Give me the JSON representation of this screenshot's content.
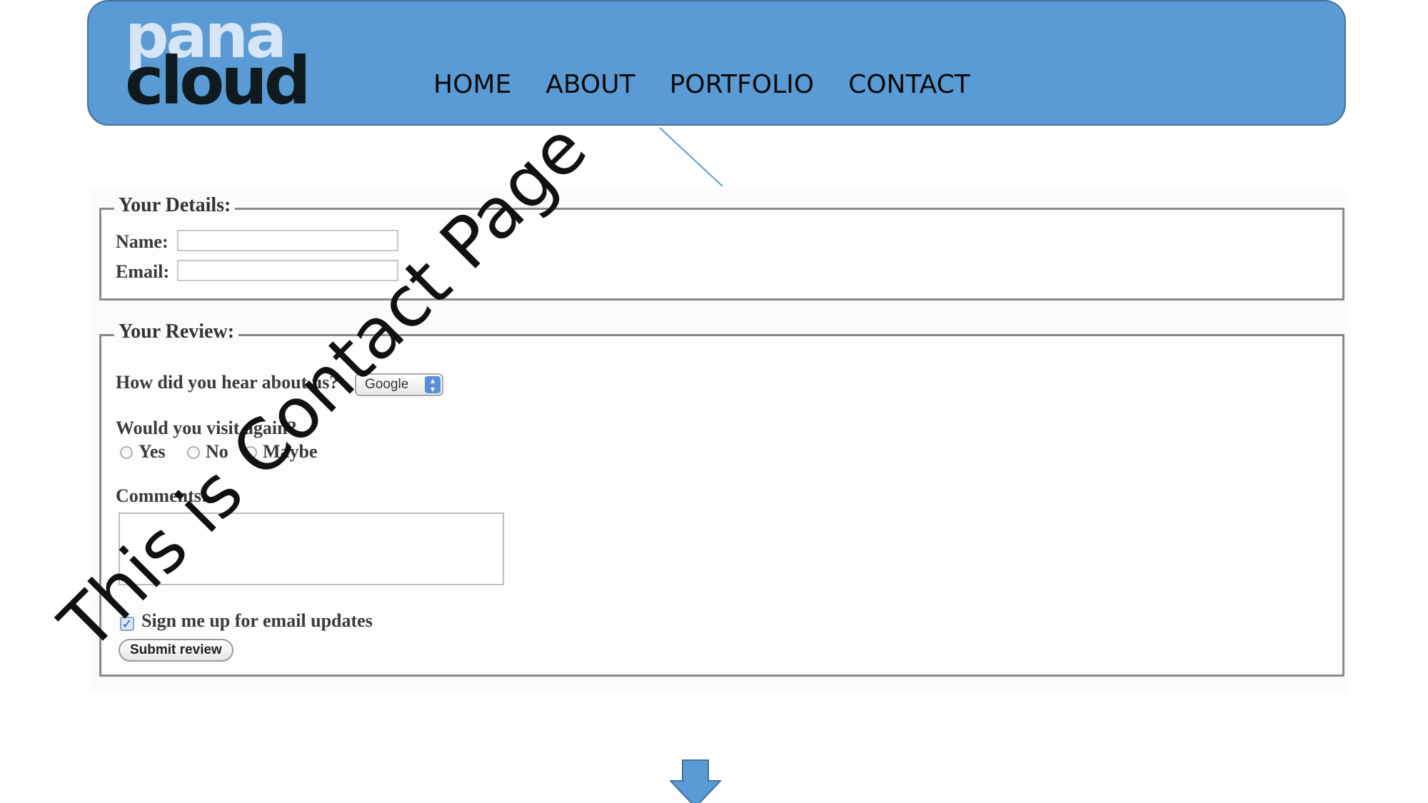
{
  "header": {
    "logo": {
      "line1": "pana",
      "line2": "cloud"
    },
    "nav": [
      {
        "label": "HOME"
      },
      {
        "label": "ABOUT"
      },
      {
        "label": "PORTFOLIO"
      },
      {
        "label": "CONTACT"
      }
    ]
  },
  "overlay_text": "This is Contact Page",
  "form": {
    "details": {
      "legend": "Your Details:",
      "name_label": "Name:",
      "name_value": "",
      "email_label": "Email:",
      "email_value": ""
    },
    "review": {
      "legend": "Your Review:",
      "heard_question": "How did you hear about us?",
      "heard_selected": "Google",
      "visit_question": "Would you visit again?",
      "visit_options": [
        "Yes",
        "No",
        "Maybe"
      ],
      "comments_label": "Comments:",
      "comments_value": "",
      "signup_label": "Sign me up for email updates",
      "signup_checked": true,
      "submit_label": "Submit review"
    }
  },
  "colors": {
    "header_bg": "#5b9bd5",
    "header_border": "#41719c",
    "logo_light": "#d6e6f6",
    "logo_dark": "#0e1a1e",
    "arrow": "#5b9bd5"
  }
}
